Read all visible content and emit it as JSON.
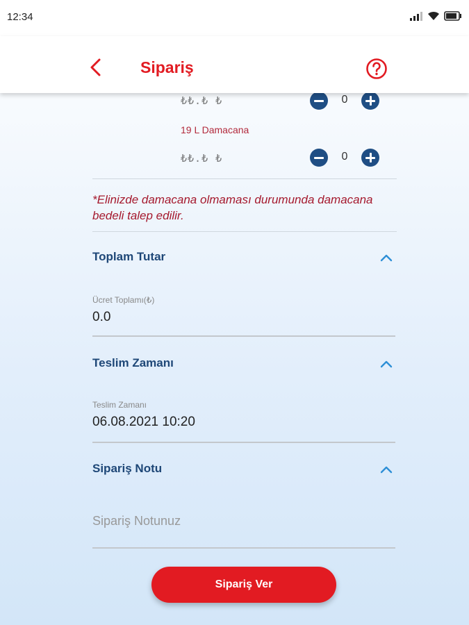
{
  "status_bar": {
    "time": "12:34"
  },
  "header": {
    "title": "Sipariş"
  },
  "products": [
    {
      "price": "₺₺.₺ ₺",
      "quantity": "0"
    },
    {
      "name": "19 L Damacana",
      "price": "₺₺.₺ ₺",
      "quantity": "0"
    }
  ],
  "warning": "*Elinizde damacana olmaması durumunda damacana bedeli talep edilir.",
  "sections": {
    "total": {
      "title": "Toplam Tutar",
      "field_label": "Ücret Toplamı(₺)",
      "field_value": "0.0"
    },
    "delivery": {
      "title": "Teslim Zamanı",
      "field_label": "Teslim Zamanı",
      "field_value": "06.08.2021 10:20"
    },
    "note": {
      "title": "Sipariş Notu",
      "placeholder": "Sipariş Notunuz"
    }
  },
  "order_button": "Sipariş Ver",
  "colors": {
    "brand_red": "#e21b22",
    "navy": "#1e4777",
    "stepper": "#1f4e84"
  }
}
